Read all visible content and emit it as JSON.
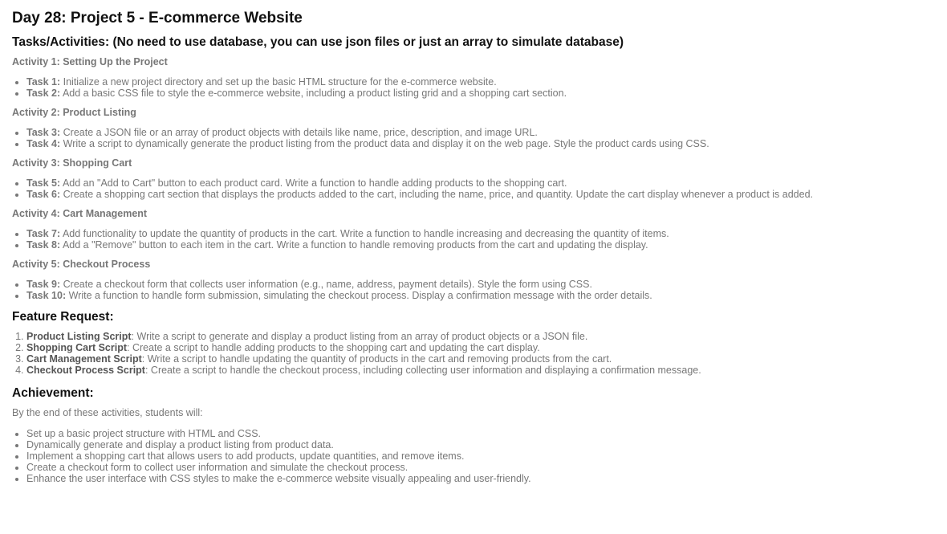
{
  "title": "Day 28: Project 5 - E-commerce Website",
  "tasks_heading": "Tasks/Activities: (No need to use database, you can use json files or just an array to simulate database)",
  "activities": [
    {
      "title": "Activity 1: Setting Up the Project",
      "tasks": [
        {
          "label": "Task 1:",
          "text": " Initialize a new project directory and set up the basic HTML structure for the e-commerce website."
        },
        {
          "label": "Task 2:",
          "text": " Add a basic CSS file to style the e-commerce website, including a product listing grid and a shopping cart section."
        }
      ]
    },
    {
      "title": "Activity 2: Product Listing",
      "tasks": [
        {
          "label": "Task 3:",
          "text": " Create a JSON file or an array of product objects with details like name, price, description, and image URL."
        },
        {
          "label": "Task 4:",
          "text": " Write a script to dynamically generate the product listing from the product data and display it on the web page. Style the product cards using CSS."
        }
      ]
    },
    {
      "title": "Activity 3: Shopping Cart",
      "tasks": [
        {
          "label": "Task 5:",
          "text": " Add an \"Add to Cart\" button to each product card. Write a function to handle adding products to the shopping cart."
        },
        {
          "label": "Task 6:",
          "text": " Create a shopping cart section that displays the products added to the cart, including the name, price, and quantity. Update the cart display whenever a product is added."
        }
      ]
    },
    {
      "title": "Activity 4: Cart Management",
      "tasks": [
        {
          "label": "Task 7:",
          "text": " Add functionality to update the quantity of products in the cart. Write a function to handle increasing and decreasing the quantity of items."
        },
        {
          "label": "Task 8:",
          "text": " Add a \"Remove\" button to each item in the cart. Write a function to handle removing products from the cart and updating the display."
        }
      ]
    },
    {
      "title": "Activity 5: Checkout Process",
      "tasks": [
        {
          "label": "Task 9:",
          "text": " Create a checkout form that collects user information (e.g., name, address, payment details). Style the form using CSS."
        },
        {
          "label": "Task 10:",
          "text": " Write a function to handle form submission, simulating the checkout process. Display a confirmation message with the order details."
        }
      ]
    }
  ],
  "feature_request": {
    "heading": "Feature Request:",
    "items": [
      {
        "label": "Product Listing Script",
        "text": ": Write a script to generate and display a product listing from an array of product objects or a JSON file."
      },
      {
        "label": "Shopping Cart Script",
        "text": ": Create a script to handle adding products to the shopping cart and updating the cart display."
      },
      {
        "label": "Cart Management Script",
        "text": ": Write a script to handle updating the quantity of products in the cart and removing products from the cart."
      },
      {
        "label": "Checkout Process Script",
        "text": ": Create a script to handle the checkout process, including collecting user information and displaying a confirmation message."
      }
    ]
  },
  "achievement": {
    "heading": "Achievement:",
    "intro": "By the end of these activities, students will:",
    "items": [
      "Set up a basic project structure with HTML and CSS.",
      "Dynamically generate and display a product listing from product data.",
      "Implement a shopping cart that allows users to add products, update quantities, and remove items.",
      "Create a checkout form to collect user information and simulate the checkout process.",
      "Enhance the user interface with CSS styles to make the e-commerce website visually appealing and user-friendly."
    ]
  }
}
